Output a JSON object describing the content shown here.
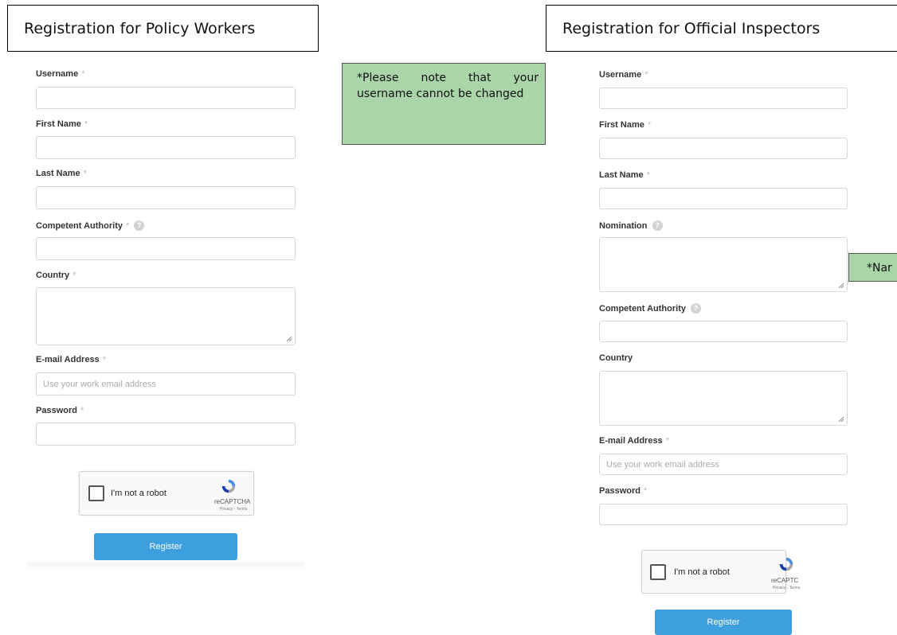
{
  "policy": {
    "title": "Registration for Policy Workers",
    "note": "*Please note that your username cannot be changed",
    "fields": {
      "username": "Username",
      "first_name": "First Name",
      "last_name": "Last Name",
      "competent_authority": "Competent Authority",
      "country": "Country",
      "email": "E-mail Address",
      "password": "Password"
    },
    "required_mark": "*",
    "help_glyph": "?",
    "email_placeholder": "Use your work email address",
    "captcha": {
      "label": "I'm not a robot",
      "brand": "reCAPTCHA",
      "terms": "Privacy - Terms"
    },
    "register": "Register"
  },
  "inspectors": {
    "title": "Registration for Official Inspectors",
    "note": "*Nar",
    "fields": {
      "username": "Username",
      "first_name": "First Name",
      "last_name": "Last Name",
      "nomination": "Nomination",
      "competent_authority": "Competent Authority",
      "country": "Country",
      "email": "E-mail Address",
      "password": "Password"
    },
    "required_mark": "*",
    "help_glyph": "?",
    "email_placeholder": "Use your work email address",
    "captcha": {
      "label": "I'm not a robot",
      "brand": "reCAPTC",
      "terms": "Privacy - Terms"
    },
    "register": "Register"
  },
  "colors": {
    "note_bg": "#a9d5a9",
    "button": "#3d9fdd"
  }
}
